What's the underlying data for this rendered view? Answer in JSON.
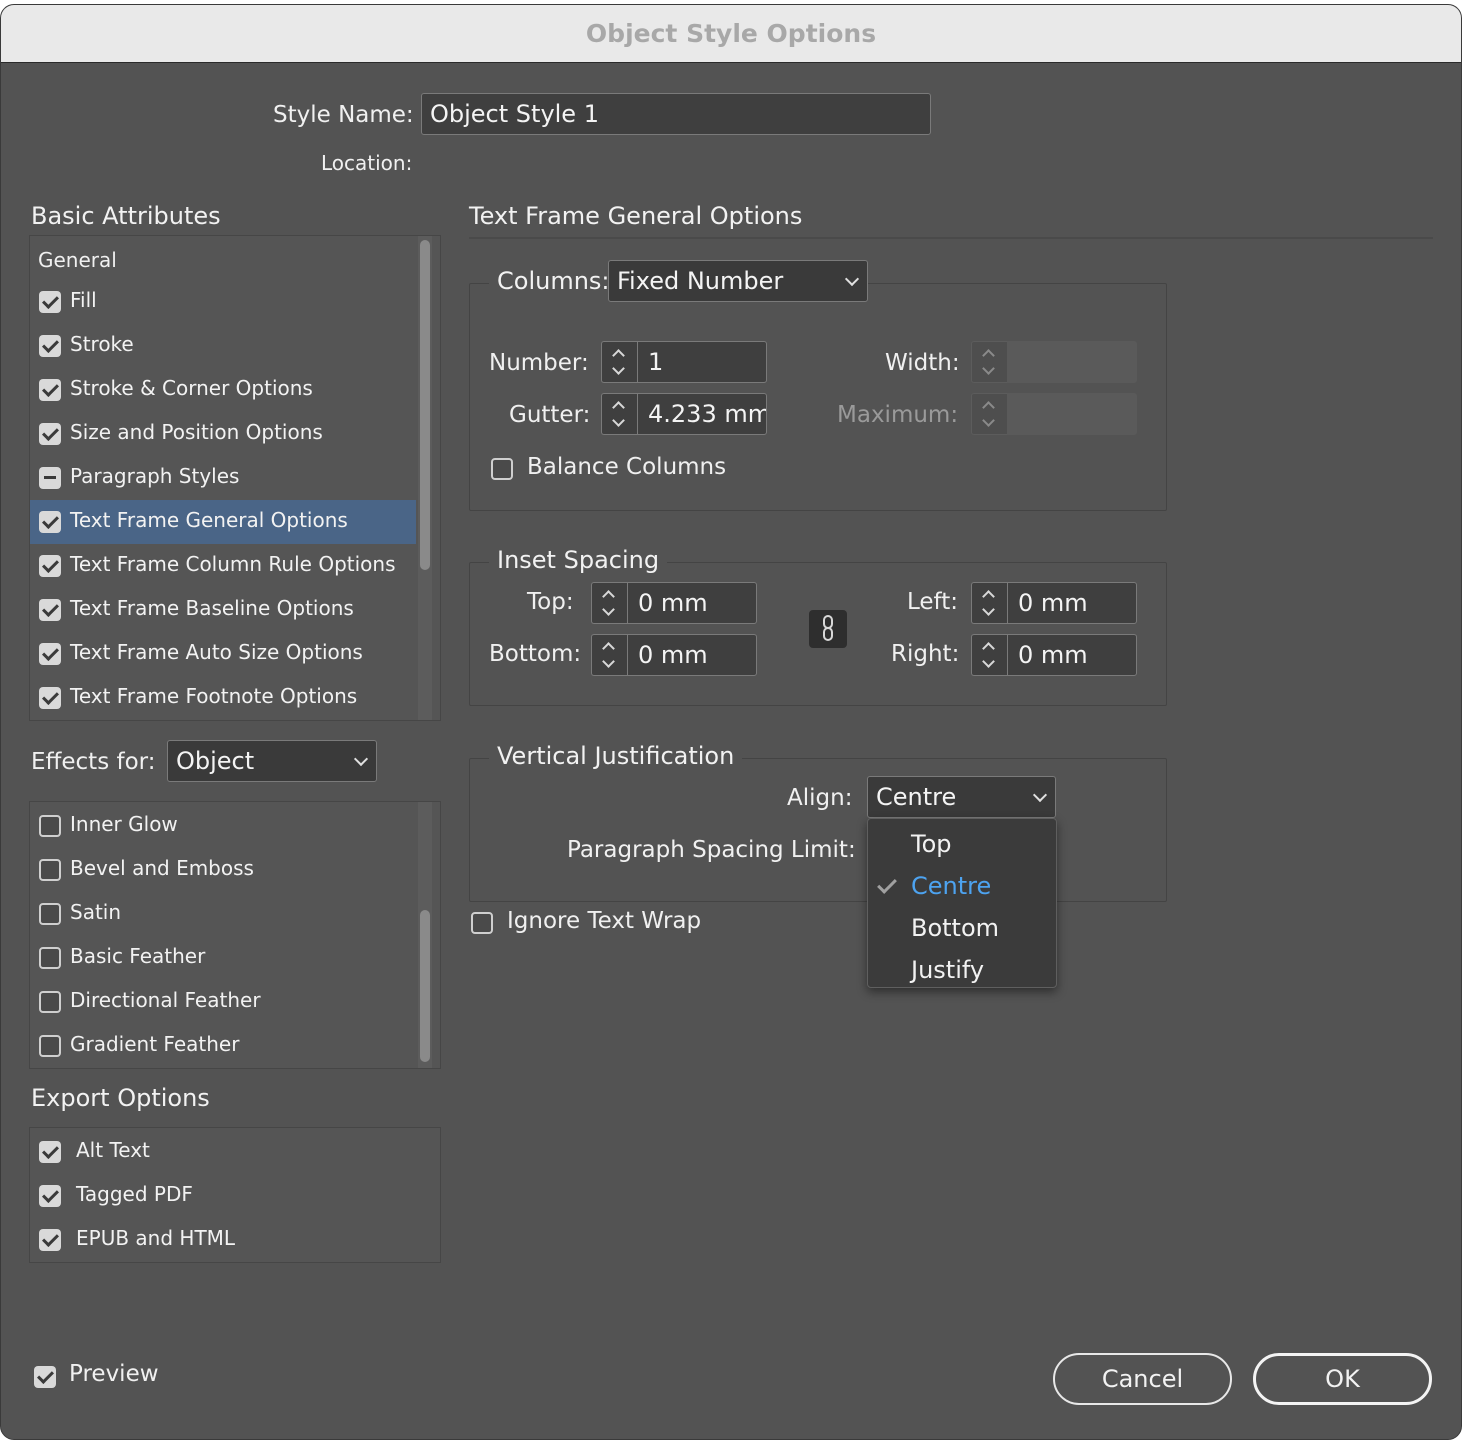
{
  "window": {
    "title": "Object Style Options"
  },
  "header": {
    "style_name_label": "Style Name:",
    "style_name_value": "Object Style 1",
    "location_label": "Location:"
  },
  "basic_attributes": {
    "title": "Basic Attributes",
    "general_label": "General",
    "items": [
      {
        "label": "Fill",
        "state": "checked"
      },
      {
        "label": "Stroke",
        "state": "checked"
      },
      {
        "label": "Stroke & Corner Options",
        "state": "checked"
      },
      {
        "label": "Size and Position Options",
        "state": "checked"
      },
      {
        "label": "Paragraph Styles",
        "state": "mixed"
      },
      {
        "label": "Text Frame General Options",
        "state": "checked",
        "selected": true
      },
      {
        "label": "Text Frame Column Rule Options",
        "state": "checked"
      },
      {
        "label": "Text Frame Baseline Options",
        "state": "checked"
      },
      {
        "label": "Text Frame Auto Size Options",
        "state": "checked"
      },
      {
        "label": "Text Frame Footnote Options",
        "state": "checked"
      }
    ]
  },
  "effects": {
    "label": "Effects for:",
    "selected": "Object",
    "items": [
      {
        "label": "Inner Glow",
        "state": "unchecked"
      },
      {
        "label": "Bevel and Emboss",
        "state": "unchecked"
      },
      {
        "label": "Satin",
        "state": "unchecked"
      },
      {
        "label": "Basic Feather",
        "state": "unchecked"
      },
      {
        "label": "Directional Feather",
        "state": "unchecked"
      },
      {
        "label": "Gradient Feather",
        "state": "unchecked"
      }
    ]
  },
  "export_options": {
    "title": "Export Options",
    "items": [
      {
        "label": "Alt Text",
        "state": "checked"
      },
      {
        "label": "Tagged PDF",
        "state": "checked"
      },
      {
        "label": "EPUB and HTML",
        "state": "checked"
      }
    ]
  },
  "panel": {
    "title": "Text Frame General Options",
    "columns": {
      "label": "Columns:",
      "mode": "Fixed Number",
      "number_label": "Number:",
      "number_value": "1",
      "gutter_label": "Gutter:",
      "gutter_value": "4.233 mm",
      "width_label": "Width:",
      "width_value": "",
      "maximum_label": "Maximum:",
      "maximum_value": "",
      "balance_label": "Balance Columns",
      "balance_checked": false
    },
    "inset": {
      "title": "Inset Spacing",
      "top_label": "Top:",
      "top_value": "0 mm",
      "bottom_label": "Bottom:",
      "bottom_value": "0 mm",
      "left_label": "Left:",
      "left_value": "0 mm",
      "right_label": "Right:",
      "right_value": "0 mm"
    },
    "vertical": {
      "title": "Vertical Justification",
      "align_label": "Align:",
      "align_value": "Centre",
      "spacing_limit_label": "Paragraph Spacing Limit:",
      "options": [
        "Top",
        "Centre",
        "Bottom",
        "Justify"
      ],
      "current": "Centre"
    },
    "ignore_wrap_label": "Ignore Text Wrap",
    "ignore_wrap_checked": false
  },
  "footer": {
    "preview_label": "Preview",
    "preview_checked": true,
    "cancel_label": "Cancel",
    "ok_label": "OK"
  },
  "colors": {
    "dialog_bg": "#535353",
    "selection": "#4a6587",
    "accent": "#4da3f0"
  }
}
